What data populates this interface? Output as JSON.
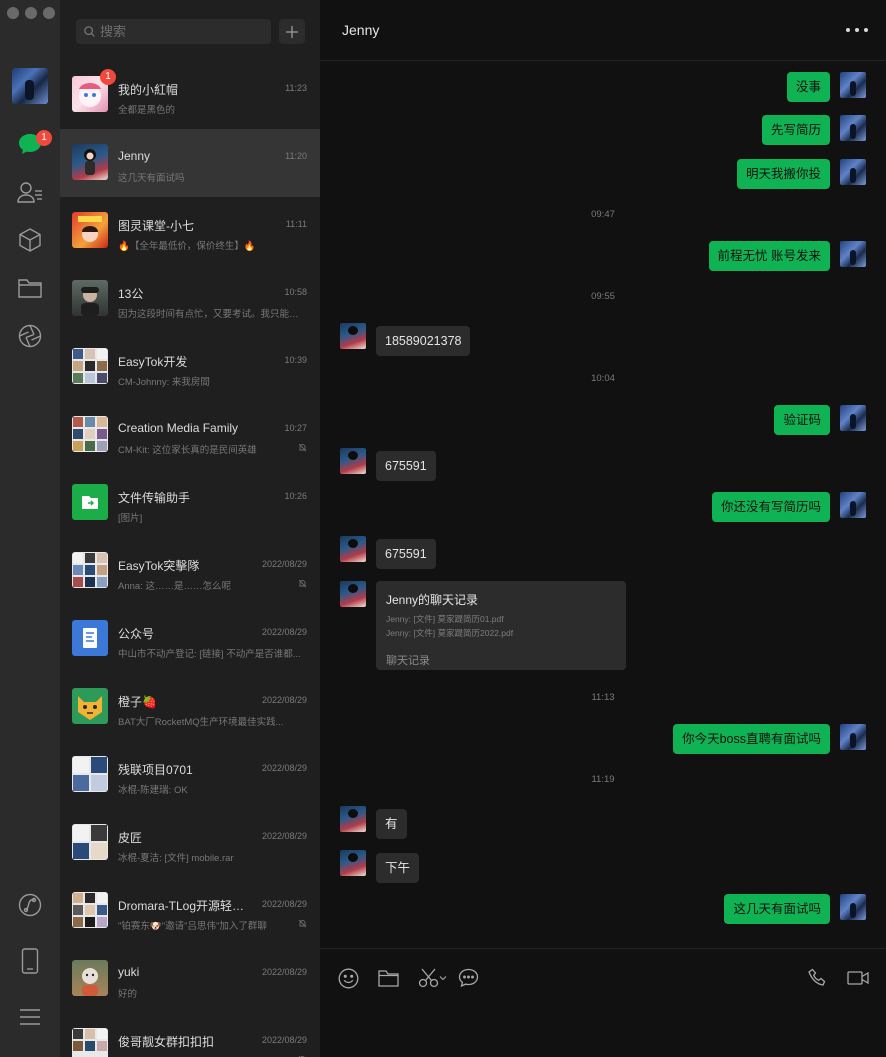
{
  "search": {
    "placeholder": "搜索"
  },
  "rail": {
    "chats_badge": "1"
  },
  "chats": [
    {
      "name": "我的小紅帽",
      "time": "11:23",
      "preview": "全都是黑色的",
      "badge": "1",
      "muted": false,
      "active": false
    },
    {
      "name": "Jenny",
      "time": "11:20",
      "preview": "这几天有面试吗",
      "badge": "",
      "muted": false,
      "active": true
    },
    {
      "name": "图灵课堂-小七",
      "time": "11:11",
      "preview": "🔥【全年最低价，保价终生】🔥",
      "badge": "",
      "muted": false,
      "active": false
    },
    {
      "name": "13公",
      "time": "10:58",
      "preview": "因为这段时间有点忙，又要考试。我只能每...",
      "badge": "",
      "muted": false,
      "active": false
    },
    {
      "name": "EasyTok开发",
      "time": "10:39",
      "preview": "CM-Johnny: 来我房間",
      "badge": "",
      "muted": false,
      "active": false
    },
    {
      "name": "Creation Media Family",
      "time": "10:27",
      "preview": "CM-Kit: 这位家长真的是民间英雄",
      "badge": "",
      "muted": true,
      "active": false
    },
    {
      "name": "文件传输助手",
      "time": "10:26",
      "preview": "[图片]",
      "badge": "",
      "muted": false,
      "active": false
    },
    {
      "name": "EasyTok突擊隊",
      "time": "2022/08/29",
      "preview": "Anna: 这……是……怎么呢",
      "badge": "",
      "muted": true,
      "active": false
    },
    {
      "name": "公众号",
      "time": "2022/08/29",
      "preview": "中山市不动产登记: [链接] 不动产是否谁都...",
      "badge": "",
      "muted": false,
      "active": false
    },
    {
      "name": "橙子🍓",
      "time": "2022/08/29",
      "preview": "BAT大厂RocketMQ生产环境最佳实践...",
      "badge": "",
      "muted": false,
      "active": false
    },
    {
      "name": "残联项目0701",
      "time": "2022/08/29",
      "preview": "冰棍-陈建瑞: OK",
      "badge": "",
      "muted": false,
      "active": false
    },
    {
      "name": "皮匠",
      "time": "2022/08/29",
      "preview": "冰棍-夏洁: [文件] mobile.rar",
      "badge": "",
      "muted": false,
      "active": false
    },
    {
      "name": "Dromara-TLog开源轻量...",
      "time": "2022/08/29",
      "preview": "\"铂赛东🐶\"邀请\"吕思伟\"加入了群聊",
      "badge": "",
      "muted": true,
      "active": false
    },
    {
      "name": "yuki",
      "time": "2022/08/29",
      "preview": "好的",
      "badge": "",
      "muted": false,
      "active": false
    },
    {
      "name": "俊哥靓女群扣扣扣",
      "time": "2022/08/29",
      "preview": "",
      "badge": "",
      "muted": true,
      "active": false
    }
  ],
  "chat": {
    "title": "Jenny",
    "messages": [
      {
        "kind": "me",
        "text": "没事"
      },
      {
        "kind": "me",
        "text": "先写简历"
      },
      {
        "kind": "me",
        "text": "明天我搬你投"
      },
      {
        "kind": "time",
        "text": "09:47"
      },
      {
        "kind": "me",
        "text": "前程无忧 账号发来"
      },
      {
        "kind": "time",
        "text": "09:55"
      },
      {
        "kind": "her",
        "text": "18589021378"
      },
      {
        "kind": "time",
        "text": "10:04"
      },
      {
        "kind": "me",
        "text": "验证码"
      },
      {
        "kind": "her",
        "text": "675591"
      },
      {
        "kind": "me",
        "text": "你还没有写简历吗"
      },
      {
        "kind": "her",
        "text": "675591"
      },
      {
        "kind": "time",
        "text": "11:13"
      },
      {
        "kind": "me",
        "text": "你今天boss直聘有面试吗"
      },
      {
        "kind": "time",
        "text": "11:19"
      },
      {
        "kind": "her",
        "text": "有"
      },
      {
        "kind": "her",
        "text": "下午"
      },
      {
        "kind": "me",
        "text": "这几天有面试吗"
      }
    ],
    "record_card": {
      "title": "Jenny的聊天记录",
      "lines": [
        "Jenny: [文件] 莫家踶简历01.pdf",
        "Jenny: [文件] 莫家踶简历2022.pdf"
      ],
      "footer": "聊天记录"
    }
  },
  "icons": {
    "rail": [
      "chat-icon",
      "contacts-icon",
      "cube-icon",
      "folder-icon",
      "aperture-icon",
      "link-icon",
      "phone-device-icon",
      "menu-icon"
    ],
    "toolbar": [
      "emoji-icon",
      "folder-icon",
      "scissors-icon",
      "chevron-down-icon",
      "chat-bubble-icon",
      "phone-icon",
      "video-icon"
    ]
  },
  "colors": {
    "accent_green": "#0fb353",
    "badge_red": "#f2493f",
    "active_row": "#353535"
  }
}
